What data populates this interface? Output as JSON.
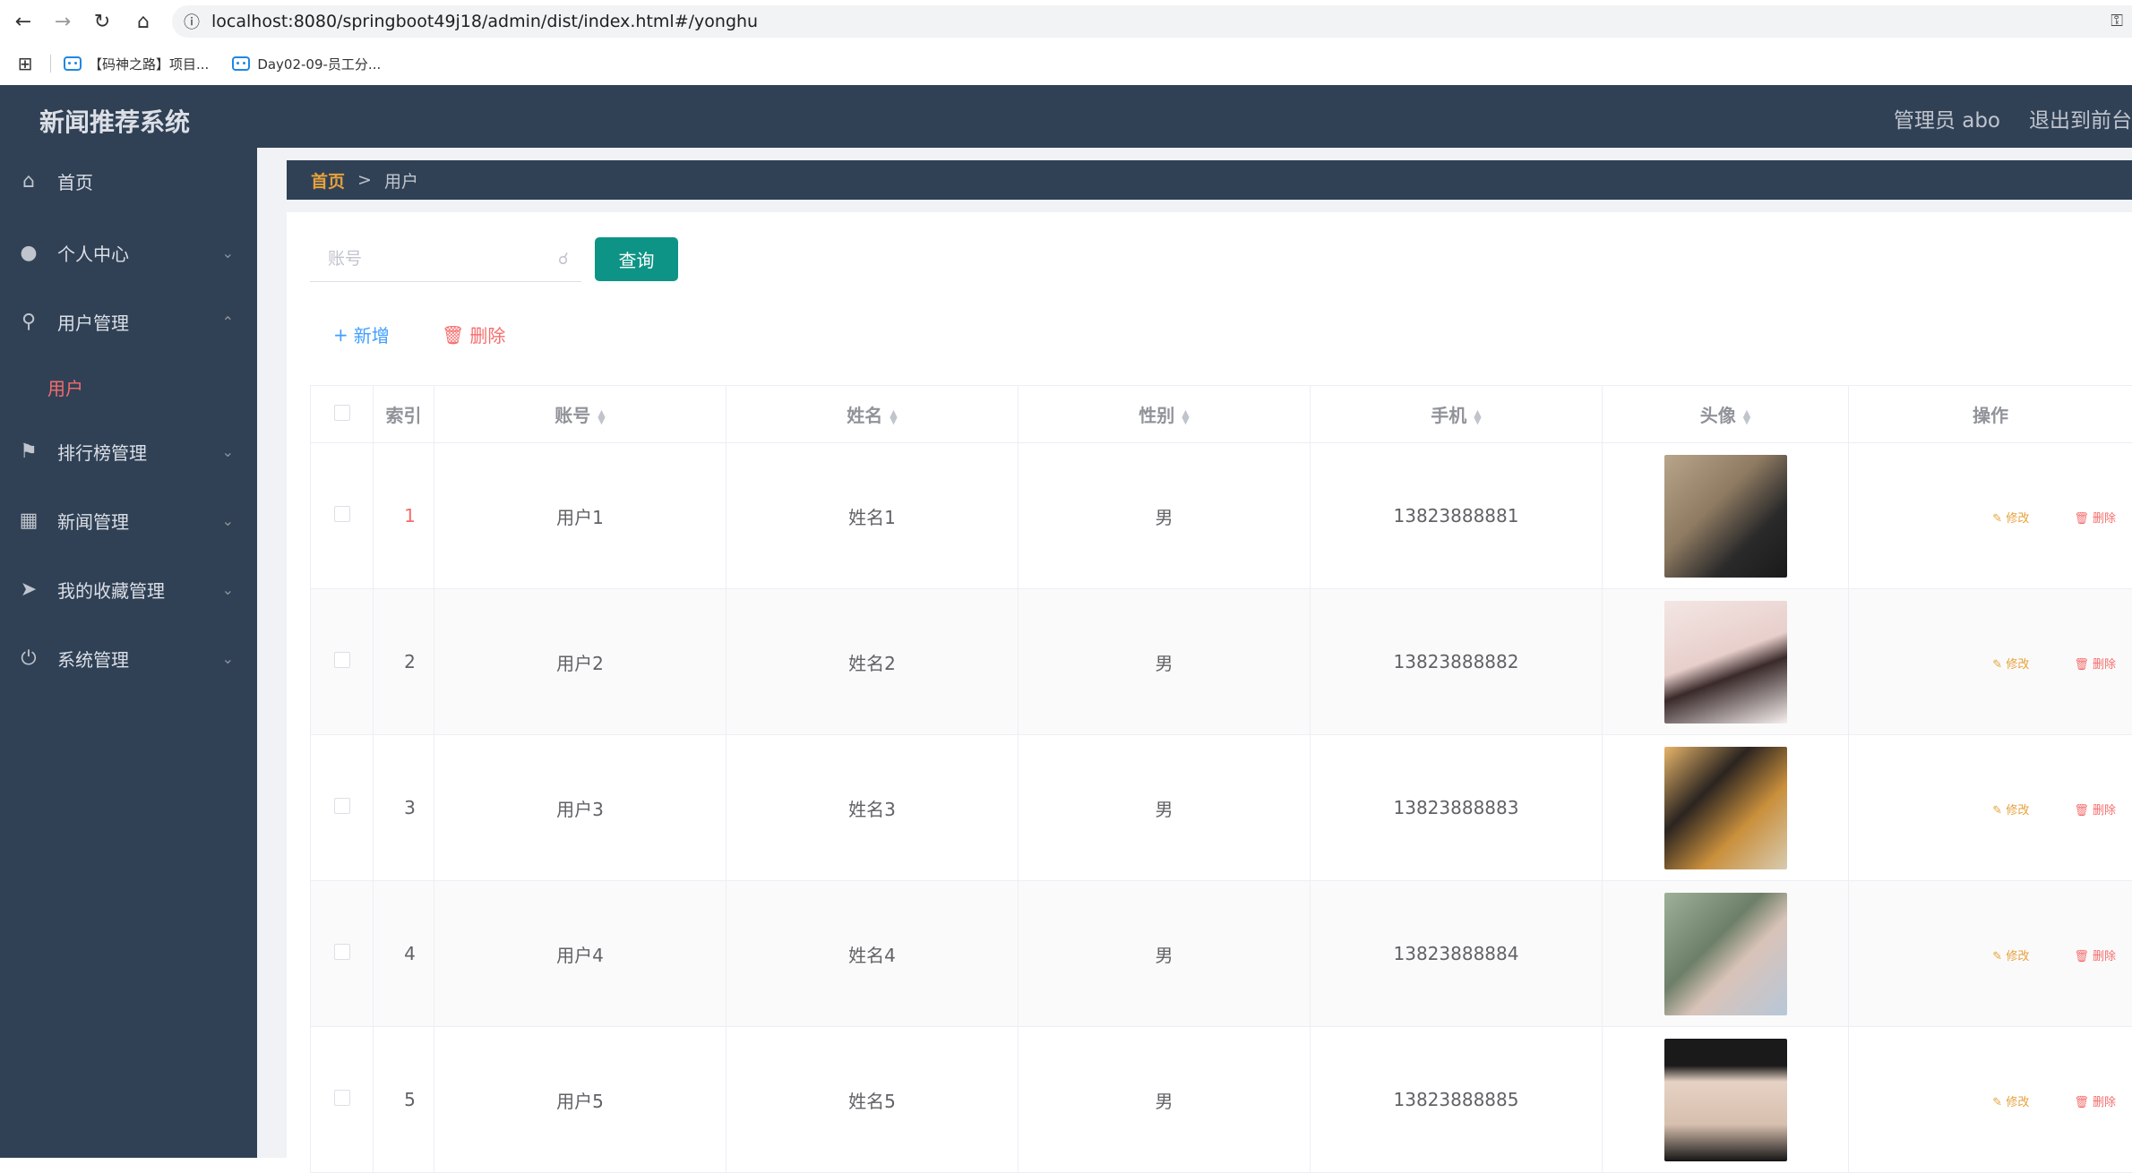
{
  "browser": {
    "url": "localhost:8080/springboot49j18/admin/dist/index.html#/yonghu",
    "bookmarks": [
      "【码神之路】项目...",
      "Day02-09-员工分..."
    ]
  },
  "header": {
    "title": "新闻推荐系统",
    "user": "管理员 abo",
    "logout": "退出到前台"
  },
  "sidebar": {
    "items": [
      {
        "label": "首页",
        "icon": "home-icon"
      },
      {
        "label": "个人中心",
        "icon": "user-icon"
      },
      {
        "label": "用户管理",
        "icon": "microphone-icon"
      },
      {
        "label": "排行榜管理",
        "icon": "flag-icon"
      },
      {
        "label": "新闻管理",
        "icon": "books-icon"
      },
      {
        "label": "我的收藏管理",
        "icon": "send-icon"
      },
      {
        "label": "系统管理",
        "icon": "power-icon"
      }
    ],
    "submenu_active": "用户"
  },
  "breadcrumb": {
    "home": "首页",
    "sep": ">",
    "current": "用户"
  },
  "search": {
    "placeholder": "账号",
    "button": "查询"
  },
  "actions": {
    "add": "新增",
    "delete": "删除"
  },
  "table": {
    "headers": [
      "索引",
      "账号",
      "姓名",
      "性别",
      "手机",
      "头像",
      "操作"
    ],
    "rows": [
      {
        "index": "1",
        "account": "用户1",
        "name": "姓名1",
        "gender": "男",
        "phone": "13823888881"
      },
      {
        "index": "2",
        "account": "用户2",
        "name": "姓名2",
        "gender": "男",
        "phone": "13823888882"
      },
      {
        "index": "3",
        "account": "用户3",
        "name": "姓名3",
        "gender": "男",
        "phone": "13823888883"
      },
      {
        "index": "4",
        "account": "用户4",
        "name": "姓名4",
        "gender": "男",
        "phone": "13823888884"
      },
      {
        "index": "5",
        "account": "用户5",
        "name": "姓名5",
        "gender": "男",
        "phone": "13823888885"
      }
    ],
    "row_edit": "修改",
    "row_delete": "删除"
  },
  "colors": {
    "sidebar_bg": "#304156",
    "accent_teal": "#0e9486",
    "active_red": "#f56c6c",
    "breadcrumb_home": "#e6a23c"
  }
}
